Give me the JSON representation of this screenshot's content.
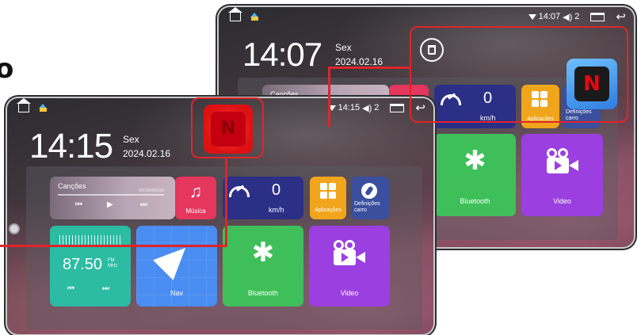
{
  "decor": {
    "glyph": "o"
  },
  "back_screen": {
    "status": {
      "time": "14:07",
      "notifications": "2",
      "icons": [
        "home-icon",
        "app-icon",
        "wifi-icon",
        "volume-icon",
        "recent-apps-icon",
        "back-icon"
      ]
    },
    "clock": {
      "time": "14:07",
      "day": "Sex",
      "date": "2024.02.16"
    },
    "music": {
      "song": "Canções"
    },
    "speed": {
      "value": "0",
      "unit": "km/h"
    },
    "apps_label": "Aplicações",
    "car_settings_label": "Definições carro",
    "bluetooth_label": "Bluetooth",
    "video_label": "Video",
    "netflix_glyph": "N"
  },
  "front_screen": {
    "status": {
      "time": "14:15",
      "notifications": "2"
    },
    "clock": {
      "time": "14:15",
      "day": "Sex",
      "date": "2024.02.16"
    },
    "music": {
      "song": "Canções",
      "time": "00:00/00:00",
      "label": "Música"
    },
    "speed": {
      "value": "0",
      "unit": "km/h"
    },
    "apps_label": "Aplicações",
    "car_settings_label": "Definições carro",
    "radio": {
      "frequency": "87.50",
      "band": "FM",
      "unit": "MHz"
    },
    "nav_label": "Nav",
    "bluetooth_label": "Bluetooth",
    "video_label": "Video",
    "netflix_glyph": "N"
  },
  "colors": {
    "callout": "#e0242b",
    "netflix_red": "#e50914",
    "music": "#e5365d",
    "speed": "#2b2f86",
    "apps": "#f1a51c",
    "car": "#3a4f9e",
    "radio": "#2bbca3",
    "nav": "#4a8df2",
    "bluetooth": "#3fbf5a",
    "video": "#9b3fe0"
  }
}
